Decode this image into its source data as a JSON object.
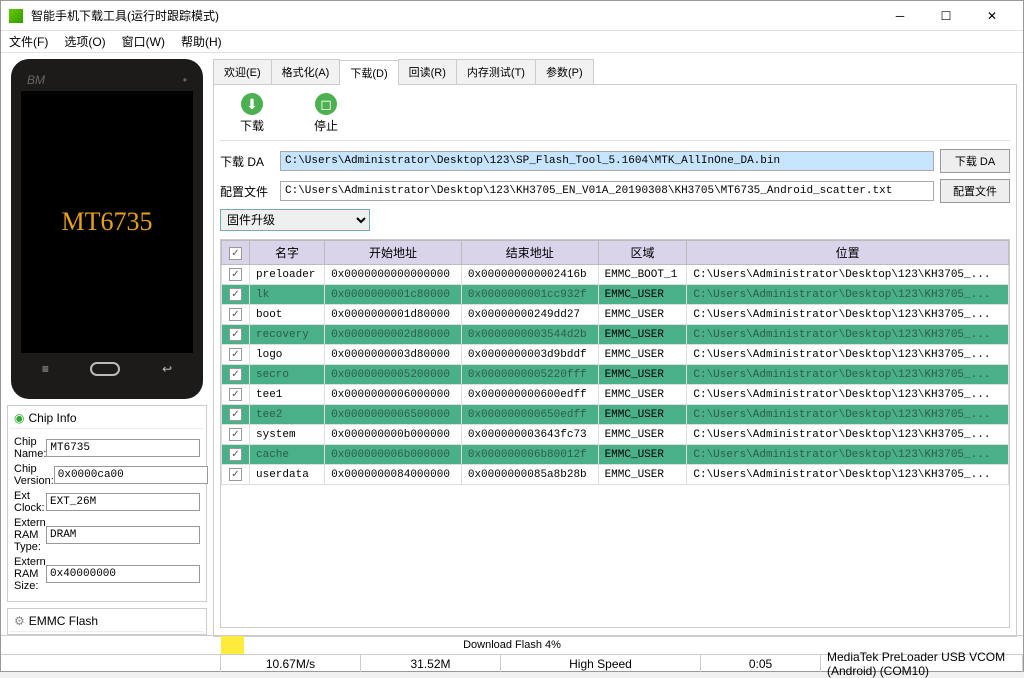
{
  "window": {
    "title": "智能手机下载工具(运行时跟踪模式)"
  },
  "menu": {
    "file": "文件(F)",
    "options": "选项(O)",
    "window": "窗口(W)",
    "help": "帮助(H)"
  },
  "left": {
    "phone_brand": "BM",
    "chip_model": "MT6735",
    "info_header": "Chip Info",
    "emmc_header": "EMMC Flash",
    "rows": {
      "chip_name_l": "Chip Name:",
      "chip_name_v": "MT6735",
      "chip_ver_l": "Chip Version:",
      "chip_ver_v": "0x0000ca00",
      "ext_clock_l": "Ext Clock:",
      "ext_clock_v": "EXT_26M",
      "ram_type_l": "Extern RAM Type:",
      "ram_type_v": "DRAM",
      "ram_size_l": "Extern RAM Size:",
      "ram_size_v": "0x40000000"
    }
  },
  "tabs": {
    "welcome": "欢迎(E)",
    "format": "格式化(A)",
    "download": "下载(D)",
    "readback": "回读(R)",
    "memtest": "内存测试(T)",
    "params": "参数(P)"
  },
  "toolbar": {
    "download": "下载",
    "stop": "停止"
  },
  "fields": {
    "da_label": "下载 DA",
    "da_value": "C:\\Users\\Administrator\\Desktop\\123\\SP_Flash_Tool_5.1604\\MTK_AllInOne_DA.bin",
    "da_button": "下载 DA",
    "scatter_label": "配置文件",
    "scatter_value": "C:\\Users\\Administrator\\Desktop\\123\\KH3705_EN_V01A_20190308\\KH3705\\MT6735_Android_scatter.txt",
    "scatter_button": "配置文件",
    "mode": "固件升级"
  },
  "table": {
    "headers": {
      "name": "名字",
      "start": "开始地址",
      "end": "结束地址",
      "region": "区域",
      "location": "位置"
    },
    "rows": [
      {
        "green": false,
        "name": "preloader",
        "start": "0x0000000000000000",
        "end": "0x000000000002416b",
        "region": "EMMC_BOOT_1",
        "location": "C:\\Users\\Administrator\\Desktop\\123\\KH3705_..."
      },
      {
        "green": true,
        "name": "lk",
        "start": "0x0000000001c80000",
        "end": "0x0000000001cc932f",
        "region": "EMMC_USER",
        "location": "C:\\Users\\Administrator\\Desktop\\123\\KH3705_..."
      },
      {
        "green": false,
        "name": "boot",
        "start": "0x0000000001d80000",
        "end": "0x00000000249dd27",
        "region": "EMMC_USER",
        "location": "C:\\Users\\Administrator\\Desktop\\123\\KH3705_..."
      },
      {
        "green": true,
        "name": "recovery",
        "start": "0x0000000002d80000",
        "end": "0x0000000003544d2b",
        "region": "EMMC_USER",
        "location": "C:\\Users\\Administrator\\Desktop\\123\\KH3705_..."
      },
      {
        "green": false,
        "name": "logo",
        "start": "0x0000000003d80000",
        "end": "0x0000000003d9bddf",
        "region": "EMMC_USER",
        "location": "C:\\Users\\Administrator\\Desktop\\123\\KH3705_..."
      },
      {
        "green": true,
        "name": "secro",
        "start": "0x0000000005200000",
        "end": "0x0000000005220fff",
        "region": "EMMC_USER",
        "location": "C:\\Users\\Administrator\\Desktop\\123\\KH3705_..."
      },
      {
        "green": false,
        "name": "tee1",
        "start": "0x0000000006000000",
        "end": "0x000000000600edff",
        "region": "EMMC_USER",
        "location": "C:\\Users\\Administrator\\Desktop\\123\\KH3705_..."
      },
      {
        "green": true,
        "name": "tee2",
        "start": "0x0000000006500000",
        "end": "0x000000000650edff",
        "region": "EMMC_USER",
        "location": "C:\\Users\\Administrator\\Desktop\\123\\KH3705_..."
      },
      {
        "green": false,
        "name": "system",
        "start": "0x000000000b000000",
        "end": "0x000000003643fc73",
        "region": "EMMC_USER",
        "location": "C:\\Users\\Administrator\\Desktop\\123\\KH3705_..."
      },
      {
        "green": true,
        "name": "cache",
        "start": "0x000000006b000000",
        "end": "0x000000006b80012f",
        "region": "EMMC_USER",
        "location": "C:\\Users\\Administrator\\Desktop\\123\\KH3705_..."
      },
      {
        "green": false,
        "name": "userdata",
        "start": "0x0000000084000000",
        "end": "0x0000000085a8b28b",
        "region": "EMMC_USER",
        "location": "C:\\Users\\Administrator\\Desktop\\123\\KH3705_..."
      }
    ]
  },
  "progress": {
    "text": "Download Flash 4%"
  },
  "status": {
    "speed": "10.67M/s",
    "size": "31.52M",
    "mode": "High Speed",
    "time": "0:05",
    "device": "MediaTek PreLoader USB VCOM (Android) (COM10)"
  }
}
